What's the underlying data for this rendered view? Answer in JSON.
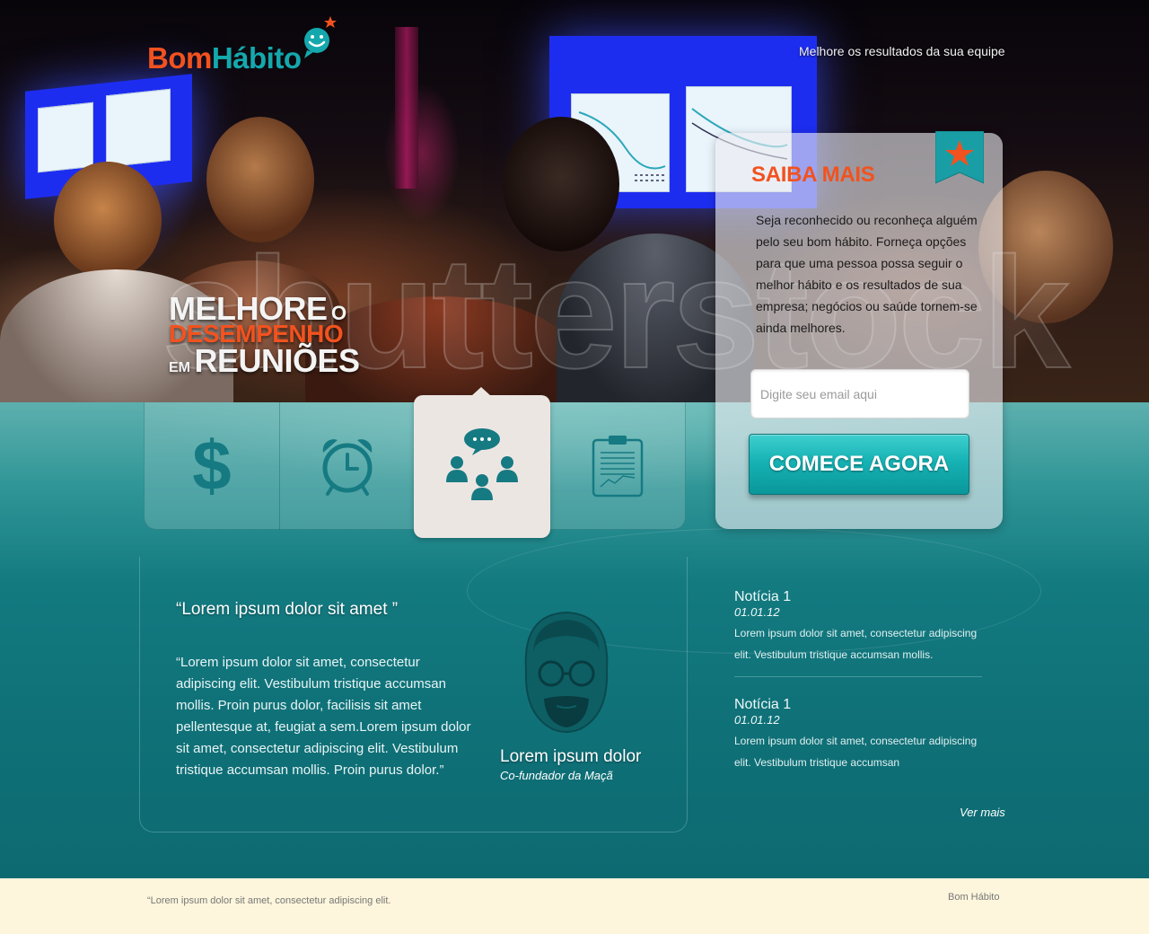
{
  "header": {
    "logo_part1": "Bom",
    "logo_part2": "Hábito",
    "tagline": "Melhore os resultados da sua equipe"
  },
  "hero": {
    "watermark": "shutterstock",
    "headline": {
      "line1_big": "MELHORE",
      "line1_small": "O",
      "line2": "DESEMPENHO",
      "line3_small": "EM",
      "line3_big": "REUNIÕES"
    }
  },
  "tabs": [
    {
      "icon": "dollar-icon",
      "active": false
    },
    {
      "icon": "alarm-clock-icon",
      "active": false
    },
    {
      "icon": "team-chat-icon",
      "active": true
    },
    {
      "icon": "clipboard-chart-icon",
      "active": false
    }
  ],
  "signup": {
    "title": "SAIBA MAIS",
    "description": "Seja reconhecido ou reconheça alguém pelo seu bom hábito. Forneça opções para que uma pessoa possa seguir o melhor hábito e os resultados de sua empresa; negócios ou saúde tornem-se ainda melhores.",
    "email_value": "",
    "email_placeholder": "Digite seu email aqui",
    "cta_label": "COMECE AGORA",
    "ribbon_icon": "star-icon"
  },
  "testimonial": {
    "title": "“Lorem ipsum dolor sit amet ”",
    "body": "“Lorem ipsum dolor sit amet, consectetur adipiscing elit. Vestibulum tristique accumsan mollis. Proin purus dolor, facilisis sit amet pellentesque at, feugiat a sem.Lorem ipsum dolor sit amet, consectetur adipiscing elit. Vestibulum tristique accumsan mollis. Proin purus dolor.”",
    "person_name": "Lorem ipsum dolor",
    "person_role": "Co-fundador da Maçã"
  },
  "news": {
    "items": [
      {
        "title": "Notícia 1",
        "date": "01.01.12",
        "text": "Lorem ipsum dolor sit amet, consectetur adipiscing elit. Vestibulum tristique accumsan mollis."
      },
      {
        "title": "Notícia 1",
        "date": "01.01.12",
        "text": "Lorem ipsum dolor sit amet, consectetur adipiscing elit. Vestibulum tristique accumsan"
      }
    ],
    "more_label": "Ver mais"
  },
  "footer": {
    "quote": "“Lorem ipsum dolor sit amet, consectetur adipiscing elit.",
    "brand": "Bom Hábito"
  },
  "colors": {
    "brand_orange": "#f2521f",
    "brand_teal": "#14a8ad",
    "section_teal": "#0f7077",
    "footer_cream": "#fdf6dc",
    "icon_teal": "#167a82"
  }
}
